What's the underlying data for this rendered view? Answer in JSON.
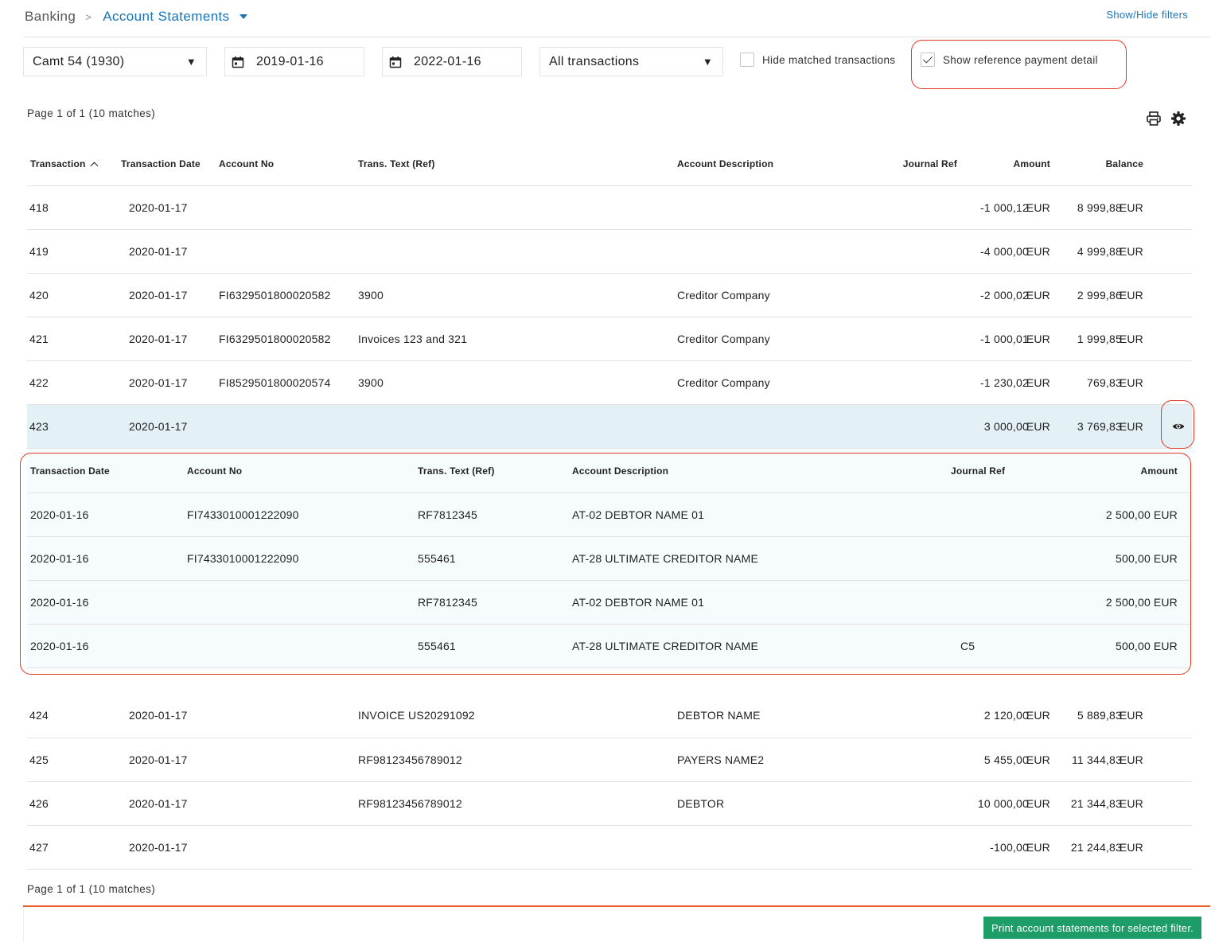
{
  "breadcrumb": {
    "root": "Banking",
    "separator": ">",
    "current": "Account Statements"
  },
  "show_hide_filters": "Show/Hide filters",
  "filters": {
    "account_select": "Camt 54 (1930)",
    "date_from": "2019-01-16",
    "date_to": "2022-01-16",
    "transaction_type": "All transactions",
    "hide_matched_label": "Hide matched transactions",
    "hide_matched_checked": false,
    "show_reference_label": "Show reference payment detail",
    "show_reference_checked": true
  },
  "page_info_top": "Page 1 of 1  (10 matches)",
  "page_info_bottom": "Page 1 of 1  (10 matches)",
  "icons": {
    "print": "print-icon",
    "settings": "gear-icon",
    "calendar": "calendar-icon",
    "view": "eye-icon"
  },
  "accent_colors": {
    "link": "#1a73b8",
    "highlight": "#e1381f",
    "primary_button": "#1f9d68",
    "selected_row": "#e3f0f6"
  },
  "table": {
    "headers": {
      "transaction": "Transaction",
      "date": "Transaction Date",
      "account": "Account No",
      "text": "Trans. Text (Ref)",
      "description": "Account Description",
      "journal": "Journal Ref",
      "amount": "Amount",
      "balance": "Balance"
    },
    "rows": [
      {
        "transaction": "418",
        "date": "2020-01-17",
        "account": "",
        "text": "",
        "description": "",
        "journal": "",
        "amount": "-1 000,12",
        "amount_cur": "EUR",
        "balance": "8 999,88",
        "balance_cur": "EUR"
      },
      {
        "transaction": "419",
        "date": "2020-01-17",
        "account": "",
        "text": "",
        "description": "",
        "journal": "",
        "amount": "-4 000,00",
        "amount_cur": "EUR",
        "balance": "4 999,88",
        "balance_cur": "EUR"
      },
      {
        "transaction": "420",
        "date": "2020-01-17",
        "account": "FI6329501800020582",
        "text": "3900",
        "description": "Creditor Company",
        "journal": "",
        "amount": "-2 000,02",
        "amount_cur": "EUR",
        "balance": "2 999,86",
        "balance_cur": "EUR"
      },
      {
        "transaction": "421",
        "date": "2020-01-17",
        "account": "FI6329501800020582",
        "text": "Invoices 123 and 321",
        "description": "Creditor Company",
        "journal": "",
        "amount": "-1 000,01",
        "amount_cur": "EUR",
        "balance": "1 999,85",
        "balance_cur": "EUR"
      },
      {
        "transaction": "422",
        "date": "2020-01-17",
        "account": "FI8529501800020574",
        "text": "3900",
        "description": "Creditor Company",
        "journal": "",
        "amount": "-1 230,02",
        "amount_cur": "EUR",
        "balance": "769,83",
        "balance_cur": "EUR"
      },
      {
        "transaction": "423",
        "date": "2020-01-17",
        "account": "",
        "text": "",
        "description": "",
        "journal": "",
        "amount": "3 000,00",
        "amount_cur": "EUR",
        "balance": "3 769,83",
        "balance_cur": "EUR",
        "selected": true
      },
      {
        "transaction": "424",
        "date": "2020-01-17",
        "account": "",
        "text": "INVOICE US20291092",
        "description": "DEBTOR NAME",
        "journal": "",
        "amount": "2 120,00",
        "amount_cur": "EUR",
        "balance": "5 889,83",
        "balance_cur": "EUR"
      },
      {
        "transaction": "425",
        "date": "2020-01-17",
        "account": "",
        "text": "RF98123456789012",
        "description": "PAYERS NAME2",
        "journal": "",
        "amount": "5 455,00",
        "amount_cur": "EUR",
        "balance": "11 344,83",
        "balance_cur": "EUR"
      },
      {
        "transaction": "426",
        "date": "2020-01-17",
        "account": "",
        "text": "RF98123456789012",
        "description": "DEBTOR",
        "journal": "",
        "amount": "10 000,00",
        "amount_cur": "EUR",
        "balance": "21 344,83",
        "balance_cur": "EUR"
      },
      {
        "transaction": "427",
        "date": "2020-01-17",
        "account": "",
        "text": "",
        "description": "",
        "journal": "",
        "amount": "-100,00",
        "amount_cur": "EUR",
        "balance": "21 244,83",
        "balance_cur": "EUR"
      }
    ]
  },
  "detail": {
    "headers": {
      "date": "Transaction Date",
      "account": "Account No",
      "text": "Trans. Text (Ref)",
      "description": "Account Description",
      "journal": "Journal Ref",
      "amount": "Amount"
    },
    "rows": [
      {
        "date": "2020-01-16",
        "account": "FI7433010001222090",
        "text": "RF7812345",
        "description": "AT-02 DEBTOR NAME 01",
        "journal": "",
        "amount": "2 500,00",
        "amount_cur": "EUR"
      },
      {
        "date": "2020-01-16",
        "account": "FI7433010001222090",
        "text": "555461",
        "description": "AT-28 ULTIMATE CREDITOR NAME",
        "journal": "",
        "amount": "500,00",
        "amount_cur": "EUR"
      },
      {
        "date": "2020-01-16",
        "account": "",
        "text": "RF7812345",
        "description": "AT-02 DEBTOR NAME 01",
        "journal": "",
        "amount": "2 500,00",
        "amount_cur": "EUR"
      },
      {
        "date": "2020-01-16",
        "account": "",
        "text": "555461",
        "description": "AT-28 ULTIMATE CREDITOR NAME",
        "journal": "C5",
        "amount": "500,00",
        "amount_cur": "EUR"
      }
    ]
  },
  "print_button": "Print account statements for selected filter."
}
